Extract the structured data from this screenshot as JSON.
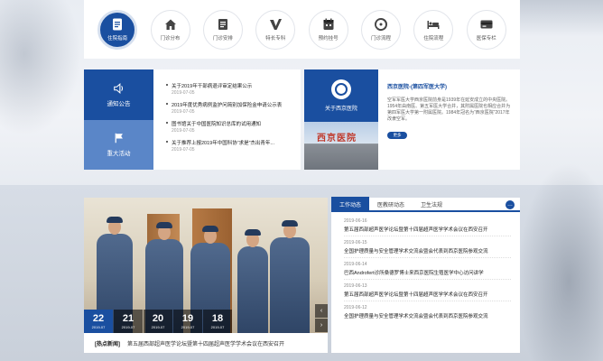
{
  "nav": {
    "items": [
      {
        "label": "住院指南",
        "icon": "document-icon",
        "active": true
      },
      {
        "label": "门诊分布",
        "icon": "home-icon",
        "active": false
      },
      {
        "label": "门诊安排",
        "icon": "calendar-list-icon",
        "active": false
      },
      {
        "label": "特长专科",
        "icon": "v-icon",
        "active": false
      },
      {
        "label": "预约挂号",
        "icon": "calendar-icon",
        "active": false
      },
      {
        "label": "门诊流程",
        "icon": "cycle-icon",
        "active": false
      },
      {
        "label": "住院流程",
        "icon": "bed-icon",
        "active": false
      },
      {
        "label": "医保专栏",
        "icon": "card-icon",
        "active": false
      }
    ]
  },
  "notice": {
    "tabs": [
      {
        "label": "通知公告",
        "icon": "speaker-icon"
      },
      {
        "label": "重大活动",
        "icon": "flag-icon"
      }
    ],
    "items": [
      {
        "title": "关于2019年干部病退评审定结果公示",
        "date": "2019-07-05"
      },
      {
        "title": "2019年度优秀病例监护问简别加保险金申请公示表",
        "date": "2019-07-05"
      },
      {
        "title": "图书馆关于中国医院知识总库的试用通知",
        "date": "2019-07-05"
      },
      {
        "title": "关于推荐上报2019年中国科协“求是”杰出青年...",
        "date": "2019-07-05"
      }
    ]
  },
  "intro": {
    "heading": "关于西京医院",
    "photo_sign": "西京医院",
    "title": "西京医院-(第四军医大学)",
    "text": "空军军医大学西京医院前身是1939年在延安成立的中央医院。1954年由南医、第五军医大学合并，其附属医院也相应合并为第四军医大学第一附属医院。1984年冠名为“西京医院”2017年改隶空军。",
    "more": "更多"
  },
  "photo_news": {
    "dates": [
      {
        "day": "22",
        "month": "2019-07"
      },
      {
        "day": "21",
        "month": "2019-07"
      },
      {
        "day": "20",
        "month": "2019-07"
      },
      {
        "day": "19",
        "month": "2019-07"
      },
      {
        "day": "18",
        "month": "2019-07"
      }
    ],
    "tag": "[热点新闻]",
    "caption": "第五届西部超声医学论坛暨第十四届超声医学学术会议在西安召开"
  },
  "work_news": {
    "tabs": [
      "工作动态",
      "医教研动态",
      "卫生法规"
    ],
    "more": "…",
    "items": [
      {
        "date": "2019-06-16",
        "title": "第五届西部超声医学论坛暨第十四届超声医学学术会议在西安召开"
      },
      {
        "date": "2019-06-15",
        "title": "全国护理质量与安全管理学术交流会暨会代表到西京医院参观交流"
      },
      {
        "date": "2019-06-14",
        "title": "巴西Androfert诊所桑德罗博士来西京医院生殖医学中心访问讲学"
      },
      {
        "date": "2019-06-13",
        "title": "第五届西部超声医学论坛暨第十四届超声医学学术会议在西安召开"
      },
      {
        "date": "2019-06-12",
        "title": "全国护理质量与安全管理学术交流会暨会代表到西京医院参观交流"
      }
    ]
  },
  "colors": {
    "primary": "#1a4fa0",
    "secondary": "#5a86c8"
  }
}
